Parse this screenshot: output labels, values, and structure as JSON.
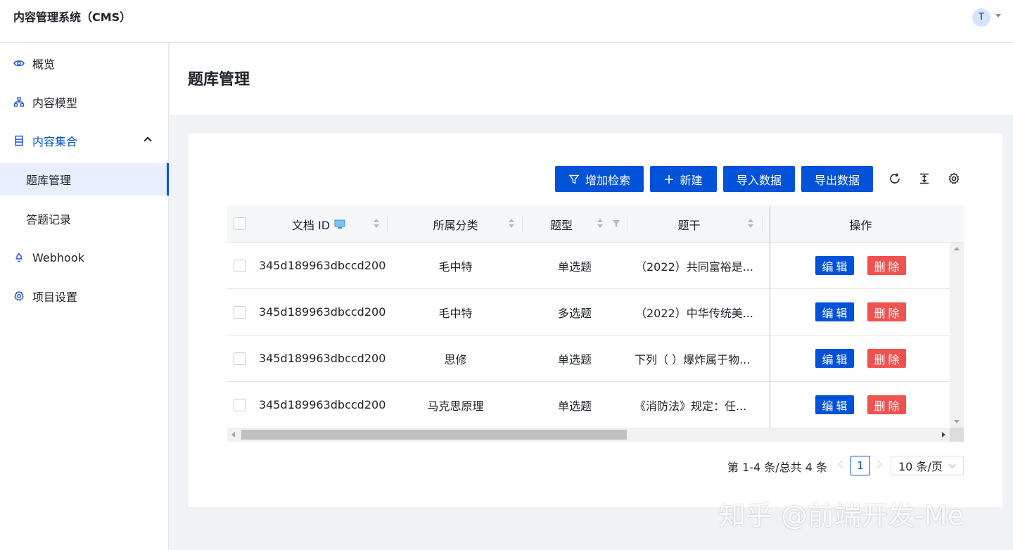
{
  "header": {
    "title": "内容管理系统（CMS）",
    "avatar_initial": "T"
  },
  "sidebar": {
    "items": [
      {
        "label": "概览",
        "icon": "eye-icon"
      },
      {
        "label": "内容模型",
        "icon": "sitemap-icon"
      },
      {
        "label": "内容集合",
        "icon": "database-icon",
        "expanded": true
      },
      {
        "label": "题库管理",
        "active": true
      },
      {
        "label": "答题记录"
      },
      {
        "label": "Webhook",
        "icon": "hook-icon"
      },
      {
        "label": "项目设置",
        "icon": "gear-icon"
      }
    ]
  },
  "page": {
    "title": "题库管理"
  },
  "toolbar": {
    "search_label": "增加检索",
    "new_label": "新建",
    "import_label": "导入数据",
    "export_label": "导出数据"
  },
  "table": {
    "columns": [
      "文档 ID",
      "所属分类",
      "题型",
      "题干",
      "操作"
    ],
    "rows": [
      {
        "id": "345d189963dbccd200...",
        "category": "毛中特",
        "type": "单选题",
        "stem": "（2022）共同富裕是..."
      },
      {
        "id": "345d189963dbccd200...",
        "category": "毛中特",
        "type": "多选题",
        "stem": "（2022）中华传统美..."
      },
      {
        "id": "345d189963dbccd200...",
        "category": "思修",
        "type": "单选题",
        "stem": "下列（ ）爆炸属于物..."
      },
      {
        "id": "345d189963dbccd200...",
        "category": "马克思原理",
        "type": "单选题",
        "stem": "《消防法》规定：任..."
      }
    ],
    "edit_label": "编辑",
    "delete_label": "删除"
  },
  "pagination": {
    "total_text": "第 1-4 条/总共 4 条",
    "current_page": "1",
    "page_size": "10 条/页"
  },
  "watermark": "知乎 @前端开发-Me",
  "colors": {
    "primary": "#0052d9",
    "danger": "#f0524f",
    "active_bg": "#e8efff"
  }
}
